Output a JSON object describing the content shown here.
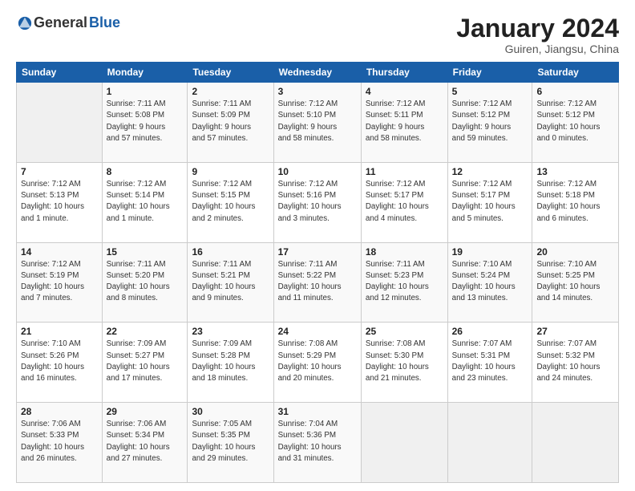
{
  "logo": {
    "general": "General",
    "blue": "Blue"
  },
  "header": {
    "month": "January 2024",
    "location": "Guiren, Jiangsu, China"
  },
  "weekdays": [
    "Sunday",
    "Monday",
    "Tuesday",
    "Wednesday",
    "Thursday",
    "Friday",
    "Saturday"
  ],
  "weeks": [
    [
      {
        "day": "",
        "info": ""
      },
      {
        "day": "1",
        "info": "Sunrise: 7:11 AM\nSunset: 5:08 PM\nDaylight: 9 hours\nand 57 minutes."
      },
      {
        "day": "2",
        "info": "Sunrise: 7:11 AM\nSunset: 5:09 PM\nDaylight: 9 hours\nand 57 minutes."
      },
      {
        "day": "3",
        "info": "Sunrise: 7:12 AM\nSunset: 5:10 PM\nDaylight: 9 hours\nand 58 minutes."
      },
      {
        "day": "4",
        "info": "Sunrise: 7:12 AM\nSunset: 5:11 PM\nDaylight: 9 hours\nand 58 minutes."
      },
      {
        "day": "5",
        "info": "Sunrise: 7:12 AM\nSunset: 5:12 PM\nDaylight: 9 hours\nand 59 minutes."
      },
      {
        "day": "6",
        "info": "Sunrise: 7:12 AM\nSunset: 5:12 PM\nDaylight: 10 hours\nand 0 minutes."
      }
    ],
    [
      {
        "day": "7",
        "info": "Sunrise: 7:12 AM\nSunset: 5:13 PM\nDaylight: 10 hours\nand 1 minute."
      },
      {
        "day": "8",
        "info": "Sunrise: 7:12 AM\nSunset: 5:14 PM\nDaylight: 10 hours\nand 1 minute."
      },
      {
        "day": "9",
        "info": "Sunrise: 7:12 AM\nSunset: 5:15 PM\nDaylight: 10 hours\nand 2 minutes."
      },
      {
        "day": "10",
        "info": "Sunrise: 7:12 AM\nSunset: 5:16 PM\nDaylight: 10 hours\nand 3 minutes."
      },
      {
        "day": "11",
        "info": "Sunrise: 7:12 AM\nSunset: 5:17 PM\nDaylight: 10 hours\nand 4 minutes."
      },
      {
        "day": "12",
        "info": "Sunrise: 7:12 AM\nSunset: 5:17 PM\nDaylight: 10 hours\nand 5 minutes."
      },
      {
        "day": "13",
        "info": "Sunrise: 7:12 AM\nSunset: 5:18 PM\nDaylight: 10 hours\nand 6 minutes."
      }
    ],
    [
      {
        "day": "14",
        "info": "Sunrise: 7:12 AM\nSunset: 5:19 PM\nDaylight: 10 hours\nand 7 minutes."
      },
      {
        "day": "15",
        "info": "Sunrise: 7:11 AM\nSunset: 5:20 PM\nDaylight: 10 hours\nand 8 minutes."
      },
      {
        "day": "16",
        "info": "Sunrise: 7:11 AM\nSunset: 5:21 PM\nDaylight: 10 hours\nand 9 minutes."
      },
      {
        "day": "17",
        "info": "Sunrise: 7:11 AM\nSunset: 5:22 PM\nDaylight: 10 hours\nand 11 minutes."
      },
      {
        "day": "18",
        "info": "Sunrise: 7:11 AM\nSunset: 5:23 PM\nDaylight: 10 hours\nand 12 minutes."
      },
      {
        "day": "19",
        "info": "Sunrise: 7:10 AM\nSunset: 5:24 PM\nDaylight: 10 hours\nand 13 minutes."
      },
      {
        "day": "20",
        "info": "Sunrise: 7:10 AM\nSunset: 5:25 PM\nDaylight: 10 hours\nand 14 minutes."
      }
    ],
    [
      {
        "day": "21",
        "info": "Sunrise: 7:10 AM\nSunset: 5:26 PM\nDaylight: 10 hours\nand 16 minutes."
      },
      {
        "day": "22",
        "info": "Sunrise: 7:09 AM\nSunset: 5:27 PM\nDaylight: 10 hours\nand 17 minutes."
      },
      {
        "day": "23",
        "info": "Sunrise: 7:09 AM\nSunset: 5:28 PM\nDaylight: 10 hours\nand 18 minutes."
      },
      {
        "day": "24",
        "info": "Sunrise: 7:08 AM\nSunset: 5:29 PM\nDaylight: 10 hours\nand 20 minutes."
      },
      {
        "day": "25",
        "info": "Sunrise: 7:08 AM\nSunset: 5:30 PM\nDaylight: 10 hours\nand 21 minutes."
      },
      {
        "day": "26",
        "info": "Sunrise: 7:07 AM\nSunset: 5:31 PM\nDaylight: 10 hours\nand 23 minutes."
      },
      {
        "day": "27",
        "info": "Sunrise: 7:07 AM\nSunset: 5:32 PM\nDaylight: 10 hours\nand 24 minutes."
      }
    ],
    [
      {
        "day": "28",
        "info": "Sunrise: 7:06 AM\nSunset: 5:33 PM\nDaylight: 10 hours\nand 26 minutes."
      },
      {
        "day": "29",
        "info": "Sunrise: 7:06 AM\nSunset: 5:34 PM\nDaylight: 10 hours\nand 27 minutes."
      },
      {
        "day": "30",
        "info": "Sunrise: 7:05 AM\nSunset: 5:35 PM\nDaylight: 10 hours\nand 29 minutes."
      },
      {
        "day": "31",
        "info": "Sunrise: 7:04 AM\nSunset: 5:36 PM\nDaylight: 10 hours\nand 31 minutes."
      },
      {
        "day": "",
        "info": ""
      },
      {
        "day": "",
        "info": ""
      },
      {
        "day": "",
        "info": ""
      }
    ]
  ]
}
